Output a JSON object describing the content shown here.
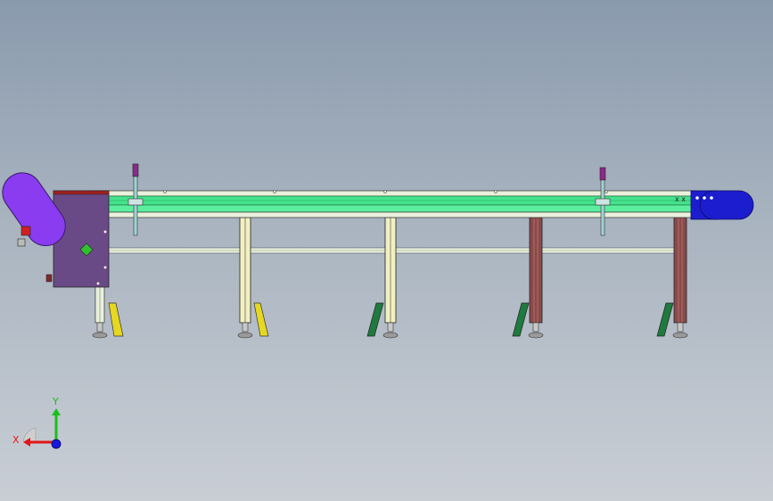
{
  "viewport": {
    "background_top": "#8a9aad",
    "background_bottom": "#c9ced5"
  },
  "model": {
    "name": "belt-conveyor-assembly",
    "colors": {
      "belt": "#44e28c",
      "belt_dark": "#1f9f55",
      "rail": "#e9f0dc",
      "drive_motor": "#8a3cf0",
      "drive_housing": "#6a4a86",
      "tail_end": "#1d1dd0",
      "leg_yellow": "#e7e08a",
      "leg_brown": "#8a4a4a",
      "foot_yellow": "#e6d820",
      "foot_green": "#1e7a3e",
      "guide_post": "#9fd2d2",
      "guide_cap": "#8a2a8a"
    }
  },
  "triad": {
    "x_label": "X",
    "y_label": "Y",
    "x_color": "#e01818",
    "y_color": "#18c018",
    "z_color": "#1818e0"
  }
}
